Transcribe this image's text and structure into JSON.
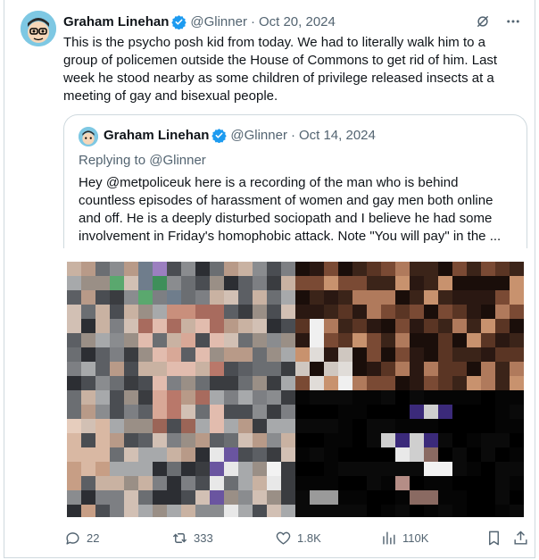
{
  "tweet": {
    "author_name": "Graham Linehan",
    "handle": "@Glinner",
    "separator": "·",
    "date": "Oct 20, 2024",
    "text": "This is the psycho posh kid from today. We had to literally walk him to a group of policemen outside the House of Commons to get rid of him. Last week he stood nearby as some children of privilege released insects at a meeting of gay and bisexual people."
  },
  "quoted_tweet": {
    "author_name": "Graham Linehan",
    "handle": "@Glinner",
    "separator": "·",
    "date": "Oct 14, 2024",
    "replying_to": "Replying to @Glinner",
    "text": "Hey @metpoliceuk here is a recording of the man who is behind countless episodes of harassment of women and gay men both online and off. He is a deeply disturbed sociopath and I believe he had some involvement in Friday's homophobic attack. Note \"You will pay\" in the ..."
  },
  "actions": {
    "replies": "22",
    "reposts": "333",
    "likes": "1.8K",
    "views": "110K"
  },
  "icons": {
    "verified": "verified-badge-icon",
    "grok": "grok-icon",
    "more": "more-icon",
    "reply": "reply-icon",
    "repost": "repost-icon",
    "like": "like-icon",
    "views": "views-icon",
    "bookmark": "bookmark-icon",
    "share": "share-icon"
  },
  "colors": {
    "verified_blue": "#1d9bf0",
    "muted_gray": "#536471",
    "text": "#0f1419",
    "border": "#cfd9de"
  }
}
